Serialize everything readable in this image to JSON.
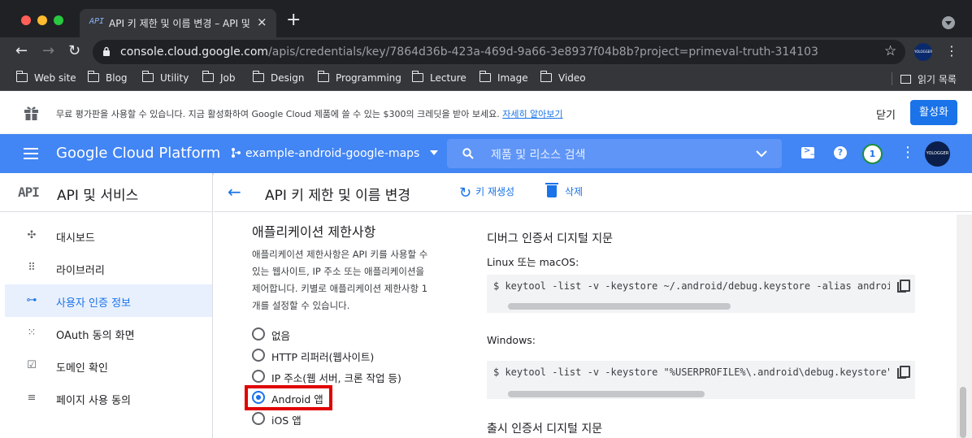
{
  "colors": {
    "chrome_dark": "#202124",
    "chrome_toolbar": "#35363a",
    "gcp_blue": "#4285f4",
    "accent": "#1a73e8",
    "highlight_red": "#e00000",
    "traffic_close": "#ff5f57",
    "traffic_min": "#febc2e",
    "traffic_max": "#28c840"
  },
  "browser": {
    "tab_favicon": "API",
    "tab_title": "API 키 제한 및 이름 변경 – API 및 서비스",
    "tab_close": "×",
    "new_tab": "+",
    "url_host": "console.cloud.google.com",
    "url_path": "/apis/credentials/key/7864d36b-423a-469d-9a66-3e8937f04b8b?project=primeval-truth-314103",
    "profile": "YOLOGGER",
    "bookmarks": [
      "Web site",
      "Blog",
      "Utility",
      "Job",
      "Design",
      "Programming",
      "Lecture",
      "Image",
      "Video"
    ],
    "reading_list": "읽기 목록"
  },
  "promo": {
    "text": "무료 평가판을 사용할 수 있습니다. 지금 활성화하여 Google Cloud 제품에 쓸 수 있는 $300의 크레딧을 받아 보세요.",
    "link": "자세히 알아보기",
    "dismiss": "닫기",
    "activate": "활성화"
  },
  "header": {
    "brand": "Google Cloud Platform",
    "project": "example-android-google-maps",
    "search_placeholder": "제품 및 리소스 검색",
    "notifications": "1",
    "avatar": "YOLOGGER"
  },
  "sidebar": {
    "api_logo": "API",
    "title": "API 및 서비스",
    "items": [
      {
        "label": "대시보드",
        "icon": "dashboard-icon",
        "glyph": "✣"
      },
      {
        "label": "라이브러리",
        "icon": "library-icon",
        "glyph": "⠿"
      },
      {
        "label": "사용자 인증 정보",
        "icon": "key-icon",
        "glyph": "⊶"
      },
      {
        "label": "OAuth 동의 화면",
        "icon": "consent-icon",
        "glyph": "⁙"
      },
      {
        "label": "도메인 확인",
        "icon": "domain-verify-icon",
        "glyph": "☑"
      },
      {
        "label": "페이지 사용 동의",
        "icon": "page-usage-icon",
        "glyph": "≡"
      }
    ],
    "active_index": 2
  },
  "main": {
    "title": "API 키 제한 및 이름 변경",
    "regenerate": "키 재생성",
    "delete": "삭제",
    "restriction": {
      "title": "애플리케이션 제한사항",
      "description": "애플리케이션 제한사항은 API 키를 사용할 수 있는 웹사이트, IP 주소 또는 애플리케이션을 제어합니다. 키별로 애플리케이션 제한사항 1개를 설정할 수 있습니다.",
      "options": [
        "없음",
        "HTTP 리퍼러(웹사이트)",
        "IP 주소(웹 서버, 크론 작업 등)",
        "Android 앱",
        "iOS 앱"
      ],
      "selected_index": 3
    },
    "fingerprint": {
      "title": "디버그 인증서 디지털 지문",
      "linux_label": "Linux 또는 macOS:",
      "linux_command": "$ keytool -list -v -keystore ~/.android/debug.keystore -alias androiddebugkey -storepass android -keypass android",
      "windows_label": "Windows:",
      "windows_command": "$ keytool -list -v -keystore \"%USERPROFILE%\\.android\\debug.keystore\" -alias androiddebugkey -storepass android -keypass android",
      "release_title": "출시 인증서 디지털 지문"
    }
  }
}
